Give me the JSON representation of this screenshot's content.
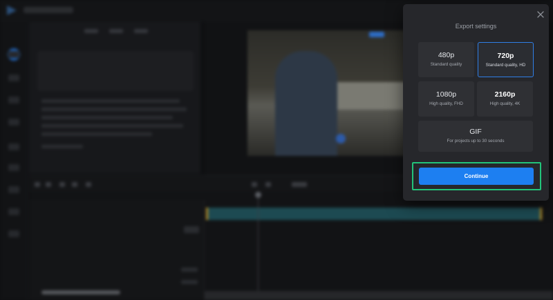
{
  "modal": {
    "title": "Export settings",
    "close_icon": "close-icon",
    "options": [
      {
        "label": "480p",
        "sub": "Standard quality",
        "selected": false
      },
      {
        "label": "720p",
        "sub": "Standard quality, HD",
        "selected": true
      },
      {
        "label": "1080p",
        "sub": "High quality, FHD",
        "selected": false
      },
      {
        "label": "2160p",
        "sub": "High quality, 4K",
        "selected": false
      },
      {
        "label": "GIF",
        "sub": "For projects up to 30 seconds",
        "selected": false
      }
    ],
    "continue_label": "Continue"
  },
  "colors": {
    "accent": "#1d7ff1",
    "selected_border": "#2f7fe8",
    "highlight": "#22c47a",
    "modal_bg": "#26272b"
  }
}
